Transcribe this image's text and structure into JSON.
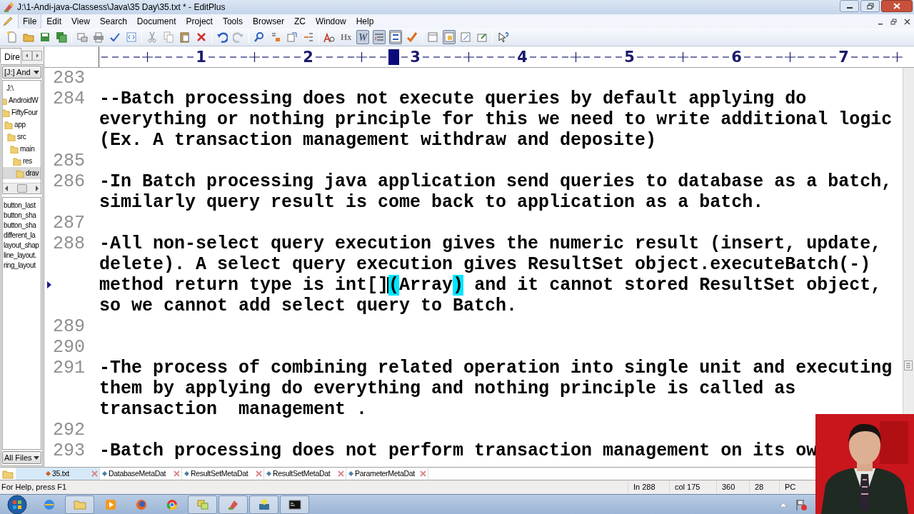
{
  "window": {
    "title": "J:\\1-Andi-java-Classess\\Java\\35 Day\\35.txt * - EditPlus"
  },
  "menu": [
    {
      "label": "File",
      "selected": true
    },
    {
      "label": "Edit",
      "selected": false
    },
    {
      "label": "View",
      "selected": false
    },
    {
      "label": "Search",
      "selected": false
    },
    {
      "label": "Document",
      "selected": false
    },
    {
      "label": "Project",
      "selected": false
    },
    {
      "label": "Tools",
      "selected": false
    },
    {
      "label": "Browser",
      "selected": false
    },
    {
      "label": "ZC",
      "selected": false
    },
    {
      "label": "Window",
      "selected": false
    },
    {
      "label": "Help",
      "selected": false
    }
  ],
  "toolbar": [
    {
      "label": "Hx",
      "pressed": false
    },
    {
      "label": "W",
      "pressed": true
    }
  ],
  "ruler": {
    "marks": [
      "1",
      "2",
      "3",
      "4",
      "5",
      "6",
      "7"
    ]
  },
  "sidebar": {
    "tab": "Dire",
    "drive": "[J:] And",
    "tree": [
      {
        "label": "J:\\",
        "selected": false,
        "children": [
          {
            "label": "AndroidW",
            "selected": false,
            "children": [
              {
                "label": "FiftyFour",
                "selected": false,
                "children": [
                  {
                    "label": "app",
                    "selected": false,
                    "children": [
                      {
                        "label": "src",
                        "selected": false,
                        "children": [
                          {
                            "label": "main",
                            "selected": false,
                            "children": [
                              {
                                "label": "res",
                                "selected": false,
                                "children": [
                                  {
                                    "label": "drav",
                                    "selected": true
                                  }
                                ]
                              }
                            ]
                          }
                        ]
                      }
                    ]
                  }
                ]
              }
            ]
          }
        ]
      }
    ],
    "files": [
      "button_last",
      "button_sha",
      "button_sha",
      "different_la",
      "layout_shap",
      "line_layout.",
      "ring_layout"
    ],
    "filter": "All Files"
  },
  "editor": {
    "lines": [
      {
        "number": "283"
      },
      {
        "number": "284",
        "rows": [
          "--Batch processing does not execute queries by default applying do",
          "everything or nothing principle for this we need to write additional logic",
          "(Ex. A transaction management withdraw and deposite)"
        ]
      },
      {
        "number": "285"
      },
      {
        "number": "286",
        "rows": [
          "-In Batch processing java application send queries to database as a batch,",
          "similarly query result is come back to application as a batch."
        ]
      },
      {
        "number": "287"
      },
      {
        "number": "288",
        "rows": [
          "-All non-select query execution gives the numeric result (insert, update,",
          "delete). A select query execution gives ResultSet object.executeBatch(-)",
          {
            "segments": [
              {
                "text": "method return type is int[]",
                "matched": false,
                "cursor": false
              },
              {
                "text": "(",
                "matched": true,
                "cursor": true
              },
              {
                "text": "Array",
                "matched": false,
                "cursor": false
              },
              {
                "text": ")",
                "matched": true,
                "cursor": false
              },
              {
                "text": " and it cannot stored ResultSet object,",
                "matched": false,
                "cursor": false
              }
            ]
          },
          "so we cannot add select query to Batch."
        ]
      },
      {
        "number": "289"
      },
      {
        "number": "290"
      },
      {
        "number": "291",
        "rows": [
          "-The process of combining related operation into single unit and executing",
          "them by applying do everything and nothing principle is called as",
          "transaction  management ."
        ]
      },
      {
        "number": "292"
      },
      {
        "number": "293",
        "rows": [
          "-Batch processing does not perform transaction management on its ow"
        ]
      }
    ]
  },
  "tabs": [
    {
      "label": "35.txt",
      "selected": true
    },
    {
      "label": "DatabaseMetaDat",
      "selected": false
    },
    {
      "label": "ResultSetMetaDat",
      "selected": false
    },
    {
      "label": "ResultSetMetaDat",
      "selected": false
    },
    {
      "label": "ParameterMetaDat",
      "selected": false
    }
  ],
  "status_bar": {
    "help": "For Help, press F1",
    "fields": [
      "In 288",
      "col 175",
      "360",
      "28",
      "PC"
    ]
  }
}
